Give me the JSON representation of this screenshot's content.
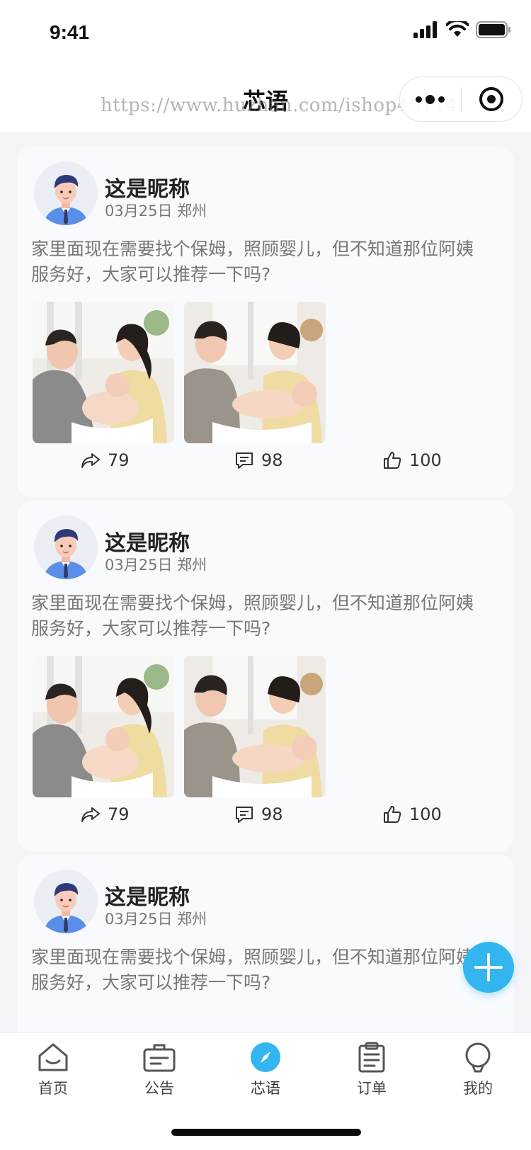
{
  "status_bar": {
    "time": "9:41"
  },
  "nav": {
    "title": "芯语",
    "watermark": "https://www.huzhan.com/ishop45114"
  },
  "posts": [
    {
      "nickname": "这是昵称",
      "date": "03月25日",
      "city": "郑州",
      "text": "家里面现在需要找个保姆，照顾婴儿，但不知道那位阿姨服务好，大家可以推荐一下吗?",
      "shares": "79",
      "comments": "98",
      "likes": "100"
    },
    {
      "nickname": "这是昵称",
      "date": "03月25日",
      "city": "郑州",
      "text": "家里面现在需要找个保姆，照顾婴儿，但不知道那位阿姨服务好，大家可以推荐一下吗?",
      "shares": "79",
      "comments": "98",
      "likes": "100"
    },
    {
      "nickname": "这是昵称",
      "date": "03月25日",
      "city": "郑州",
      "text": "家里面现在需要找个保姆，照顾婴儿，但不知道那位阿姨服务好，大家可以推荐一下吗?"
    }
  ],
  "tabbar": {
    "items": [
      {
        "label": "首页",
        "icon": "home-icon",
        "active": false
      },
      {
        "label": "公告",
        "icon": "briefcase-icon",
        "active": false
      },
      {
        "label": "芯语",
        "icon": "compass-icon",
        "active": true
      },
      {
        "label": "订单",
        "icon": "clipboard-icon",
        "active": false
      },
      {
        "label": "我的",
        "icon": "user-icon",
        "active": false
      }
    ]
  },
  "colors": {
    "accent": "#33b5ef",
    "background": "#f3f5f9",
    "card": "#f9fafd"
  }
}
